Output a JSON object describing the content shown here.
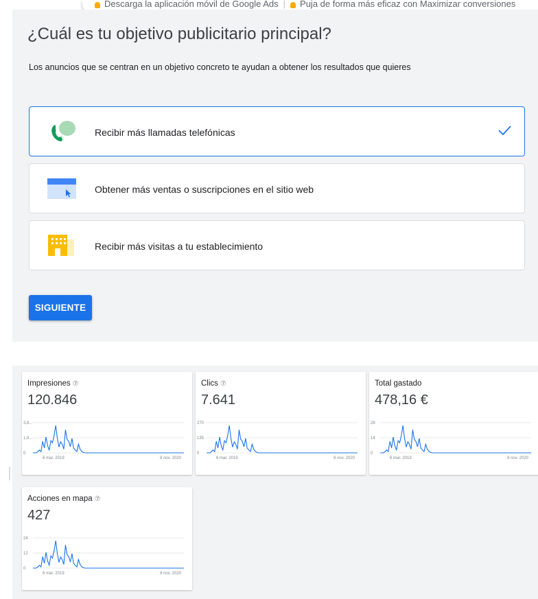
{
  "notifications": [
    {
      "icon": "lightbulb-icon",
      "text": "Descarga la aplicación móvil de Google Ads"
    },
    {
      "icon": "lightbulb-icon",
      "text": "Puja de forma más eficaz con Maximizar conversiones"
    }
  ],
  "goal": {
    "title": "¿Cuál es tu objetivo publicitario principal?",
    "subtitle": "Los anuncios que se centran en un objetivo concreto te ayudan a obtener los resultados que quieres",
    "options": [
      {
        "label": "Recibir más llamadas telefónicas",
        "icon": "phone-call-icon",
        "selected": true
      },
      {
        "label": "Obtener más ventas o suscripciones en el sitio web",
        "icon": "website-icon",
        "selected": false
      },
      {
        "label": "Recibir más visitas a tu establecimiento",
        "icon": "store-icon",
        "selected": false
      }
    ],
    "next_label": "SIGUIENTE"
  },
  "stats": [
    {
      "name": "Impresiones",
      "help": true,
      "value": "120.846",
      "y_ticks": [
        "3,8...",
        "1,9...",
        "0"
      ],
      "x_start": "6 mar. 2019",
      "x_end": "8 nov. 2020"
    },
    {
      "name": "Clics",
      "help": true,
      "value": "7.641",
      "y_ticks": [
        "270",
        "135",
        "0"
      ],
      "x_start": "6 mar. 2019",
      "x_end": "8 nov. 2020"
    },
    {
      "name": "Total gastado",
      "help": false,
      "value": "478,16 €",
      "y_ticks": [
        "28",
        "14",
        "0"
      ],
      "x_start": "6 mar. 2019",
      "x_end": "8 nov. 2020"
    },
    {
      "name": "Acciones en mapa",
      "help": true,
      "value": "427",
      "y_ticks": [
        "24",
        "12",
        "0"
      ],
      "x_start": "6 mar. 2019",
      "x_end": "8 nov. 2020"
    }
  ],
  "colors": {
    "accent": "#1a73e8",
    "panel_bg": "#f1f3f4",
    "phone_green": "#0f9d58",
    "bulb_yellow": "#f9ab00",
    "store_yellow": "#fbbc04"
  }
}
